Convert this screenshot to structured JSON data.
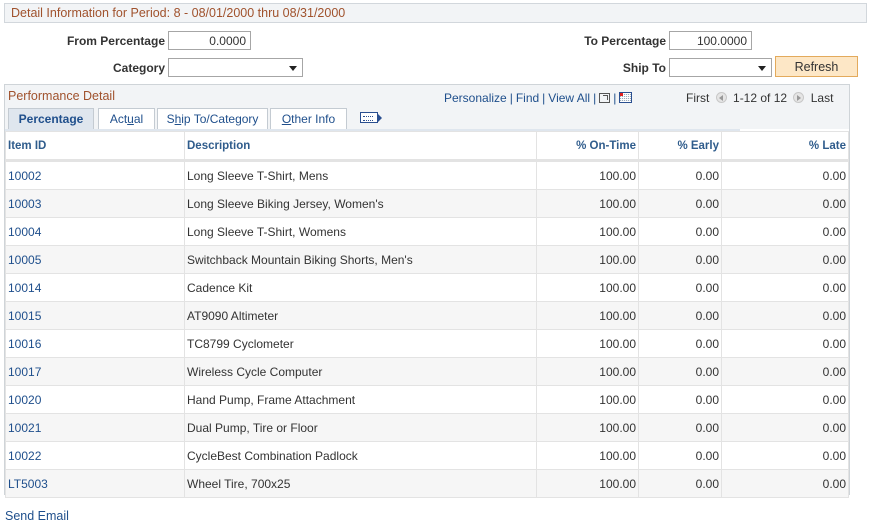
{
  "header": {
    "title": "Detail Information for Period: 8 - 08/01/2000 thru 08/31/2000"
  },
  "criteria": {
    "from_percentage_label": "From Percentage",
    "from_percentage_value": "0.0000",
    "to_percentage_label": "To Percentage",
    "to_percentage_value": "100.0000",
    "category_label": "Category",
    "category_value": "",
    "ship_to_label": "Ship To",
    "ship_to_value": "",
    "refresh_label": "Refresh"
  },
  "grid": {
    "title": "Performance Detail",
    "nav": {
      "personalize": "Personalize",
      "find": "Find",
      "view_all": "View All",
      "separator": "|"
    },
    "pager": {
      "first": "First",
      "range": "1-12 of 12",
      "last": "Last"
    },
    "tabs": [
      {
        "label_pre": "Percentage",
        "label_u": "",
        "label_post": "",
        "active": true
      },
      {
        "label_pre": "Act",
        "label_u": "u",
        "label_post": "al",
        "active": false
      },
      {
        "label_pre": "S",
        "label_u": "h",
        "label_post": "ip To/Category",
        "active": false
      },
      {
        "label_pre": "",
        "label_u": "O",
        "label_post": "ther Info",
        "active": false
      }
    ],
    "columns": [
      "Item ID",
      "Description",
      "% On-Time",
      "% Early",
      "% Late"
    ],
    "rows": [
      {
        "item_id": "10002",
        "description": "Long Sleeve T-Shirt, Mens",
        "on_time": "100.00",
        "early": "0.00",
        "late": "0.00"
      },
      {
        "item_id": "10003",
        "description": "Long Sleeve Biking Jersey, Women's",
        "on_time": "100.00",
        "early": "0.00",
        "late": "0.00"
      },
      {
        "item_id": "10004",
        "description": "Long Sleeve T-Shirt, Womens",
        "on_time": "100.00",
        "early": "0.00",
        "late": "0.00"
      },
      {
        "item_id": "10005",
        "description": "Switchback Mountain Biking Shorts, Men's",
        "on_time": "100.00",
        "early": "0.00",
        "late": "0.00"
      },
      {
        "item_id": "10014",
        "description": "Cadence Kit",
        "on_time": "100.00",
        "early": "0.00",
        "late": "0.00"
      },
      {
        "item_id": "10015",
        "description": "AT9090 Altimeter",
        "on_time": "100.00",
        "early": "0.00",
        "late": "0.00"
      },
      {
        "item_id": "10016",
        "description": "TC8799 Cyclometer",
        "on_time": "100.00",
        "early": "0.00",
        "late": "0.00"
      },
      {
        "item_id": "10017",
        "description": "Wireless Cycle Computer",
        "on_time": "100.00",
        "early": "0.00",
        "late": "0.00"
      },
      {
        "item_id": "10020",
        "description": "Hand Pump, Frame Attachment",
        "on_time": "100.00",
        "early": "0.00",
        "late": "0.00"
      },
      {
        "item_id": "10021",
        "description": "Dual Pump, Tire or Floor",
        "on_time": "100.00",
        "early": "0.00",
        "late": "0.00"
      },
      {
        "item_id": "10022",
        "description": "CycleBest Combination Padlock",
        "on_time": "100.00",
        "early": "0.00",
        "late": "0.00"
      },
      {
        "item_id": "LT5003",
        "description": "Wheel Tire, 700x25",
        "on_time": "100.00",
        "early": "0.00",
        "late": "0.00"
      }
    ]
  },
  "footer": {
    "send_email": "Send Email"
  },
  "colors": {
    "accent_title": "#a0522d",
    "link": "#1f4f8c",
    "refresh_bg": "#fde7c6"
  }
}
